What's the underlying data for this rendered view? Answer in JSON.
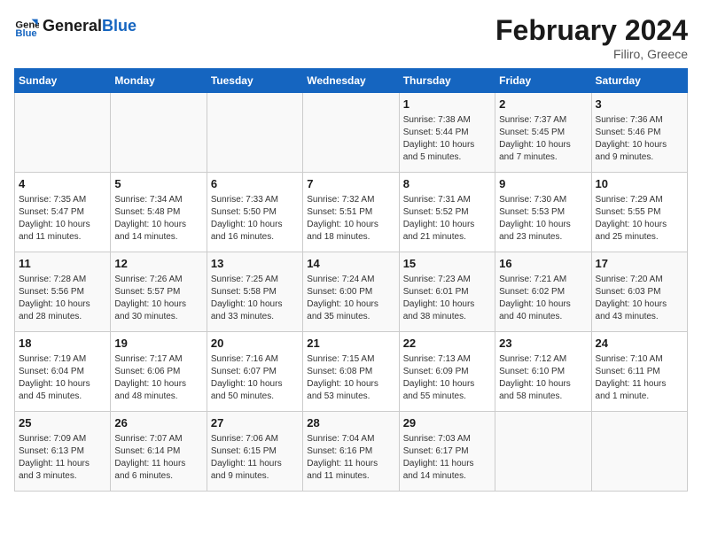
{
  "header": {
    "logo_general": "General",
    "logo_blue": "Blue",
    "month_title": "February 2024",
    "subtitle": "Filiro, Greece"
  },
  "days_of_week": [
    "Sunday",
    "Monday",
    "Tuesday",
    "Wednesday",
    "Thursday",
    "Friday",
    "Saturday"
  ],
  "weeks": [
    [
      {
        "day": "",
        "info": ""
      },
      {
        "day": "",
        "info": ""
      },
      {
        "day": "",
        "info": ""
      },
      {
        "day": "",
        "info": ""
      },
      {
        "day": "1",
        "info": "Sunrise: 7:38 AM\nSunset: 5:44 PM\nDaylight: 10 hours\nand 5 minutes."
      },
      {
        "day": "2",
        "info": "Sunrise: 7:37 AM\nSunset: 5:45 PM\nDaylight: 10 hours\nand 7 minutes."
      },
      {
        "day": "3",
        "info": "Sunrise: 7:36 AM\nSunset: 5:46 PM\nDaylight: 10 hours\nand 9 minutes."
      }
    ],
    [
      {
        "day": "4",
        "info": "Sunrise: 7:35 AM\nSunset: 5:47 PM\nDaylight: 10 hours\nand 11 minutes."
      },
      {
        "day": "5",
        "info": "Sunrise: 7:34 AM\nSunset: 5:48 PM\nDaylight: 10 hours\nand 14 minutes."
      },
      {
        "day": "6",
        "info": "Sunrise: 7:33 AM\nSunset: 5:50 PM\nDaylight: 10 hours\nand 16 minutes."
      },
      {
        "day": "7",
        "info": "Sunrise: 7:32 AM\nSunset: 5:51 PM\nDaylight: 10 hours\nand 18 minutes."
      },
      {
        "day": "8",
        "info": "Sunrise: 7:31 AM\nSunset: 5:52 PM\nDaylight: 10 hours\nand 21 minutes."
      },
      {
        "day": "9",
        "info": "Sunrise: 7:30 AM\nSunset: 5:53 PM\nDaylight: 10 hours\nand 23 minutes."
      },
      {
        "day": "10",
        "info": "Sunrise: 7:29 AM\nSunset: 5:55 PM\nDaylight: 10 hours\nand 25 minutes."
      }
    ],
    [
      {
        "day": "11",
        "info": "Sunrise: 7:28 AM\nSunset: 5:56 PM\nDaylight: 10 hours\nand 28 minutes."
      },
      {
        "day": "12",
        "info": "Sunrise: 7:26 AM\nSunset: 5:57 PM\nDaylight: 10 hours\nand 30 minutes."
      },
      {
        "day": "13",
        "info": "Sunrise: 7:25 AM\nSunset: 5:58 PM\nDaylight: 10 hours\nand 33 minutes."
      },
      {
        "day": "14",
        "info": "Sunrise: 7:24 AM\nSunset: 6:00 PM\nDaylight: 10 hours\nand 35 minutes."
      },
      {
        "day": "15",
        "info": "Sunrise: 7:23 AM\nSunset: 6:01 PM\nDaylight: 10 hours\nand 38 minutes."
      },
      {
        "day": "16",
        "info": "Sunrise: 7:21 AM\nSunset: 6:02 PM\nDaylight: 10 hours\nand 40 minutes."
      },
      {
        "day": "17",
        "info": "Sunrise: 7:20 AM\nSunset: 6:03 PM\nDaylight: 10 hours\nand 43 minutes."
      }
    ],
    [
      {
        "day": "18",
        "info": "Sunrise: 7:19 AM\nSunset: 6:04 PM\nDaylight: 10 hours\nand 45 minutes."
      },
      {
        "day": "19",
        "info": "Sunrise: 7:17 AM\nSunset: 6:06 PM\nDaylight: 10 hours\nand 48 minutes."
      },
      {
        "day": "20",
        "info": "Sunrise: 7:16 AM\nSunset: 6:07 PM\nDaylight: 10 hours\nand 50 minutes."
      },
      {
        "day": "21",
        "info": "Sunrise: 7:15 AM\nSunset: 6:08 PM\nDaylight: 10 hours\nand 53 minutes."
      },
      {
        "day": "22",
        "info": "Sunrise: 7:13 AM\nSunset: 6:09 PM\nDaylight: 10 hours\nand 55 minutes."
      },
      {
        "day": "23",
        "info": "Sunrise: 7:12 AM\nSunset: 6:10 PM\nDaylight: 10 hours\nand 58 minutes."
      },
      {
        "day": "24",
        "info": "Sunrise: 7:10 AM\nSunset: 6:11 PM\nDaylight: 11 hours\nand 1 minute."
      }
    ],
    [
      {
        "day": "25",
        "info": "Sunrise: 7:09 AM\nSunset: 6:13 PM\nDaylight: 11 hours\nand 3 minutes."
      },
      {
        "day": "26",
        "info": "Sunrise: 7:07 AM\nSunset: 6:14 PM\nDaylight: 11 hours\nand 6 minutes."
      },
      {
        "day": "27",
        "info": "Sunrise: 7:06 AM\nSunset: 6:15 PM\nDaylight: 11 hours\nand 9 minutes."
      },
      {
        "day": "28",
        "info": "Sunrise: 7:04 AM\nSunset: 6:16 PM\nDaylight: 11 hours\nand 11 minutes."
      },
      {
        "day": "29",
        "info": "Sunrise: 7:03 AM\nSunset: 6:17 PM\nDaylight: 11 hours\nand 14 minutes."
      },
      {
        "day": "",
        "info": ""
      },
      {
        "day": "",
        "info": ""
      }
    ]
  ]
}
